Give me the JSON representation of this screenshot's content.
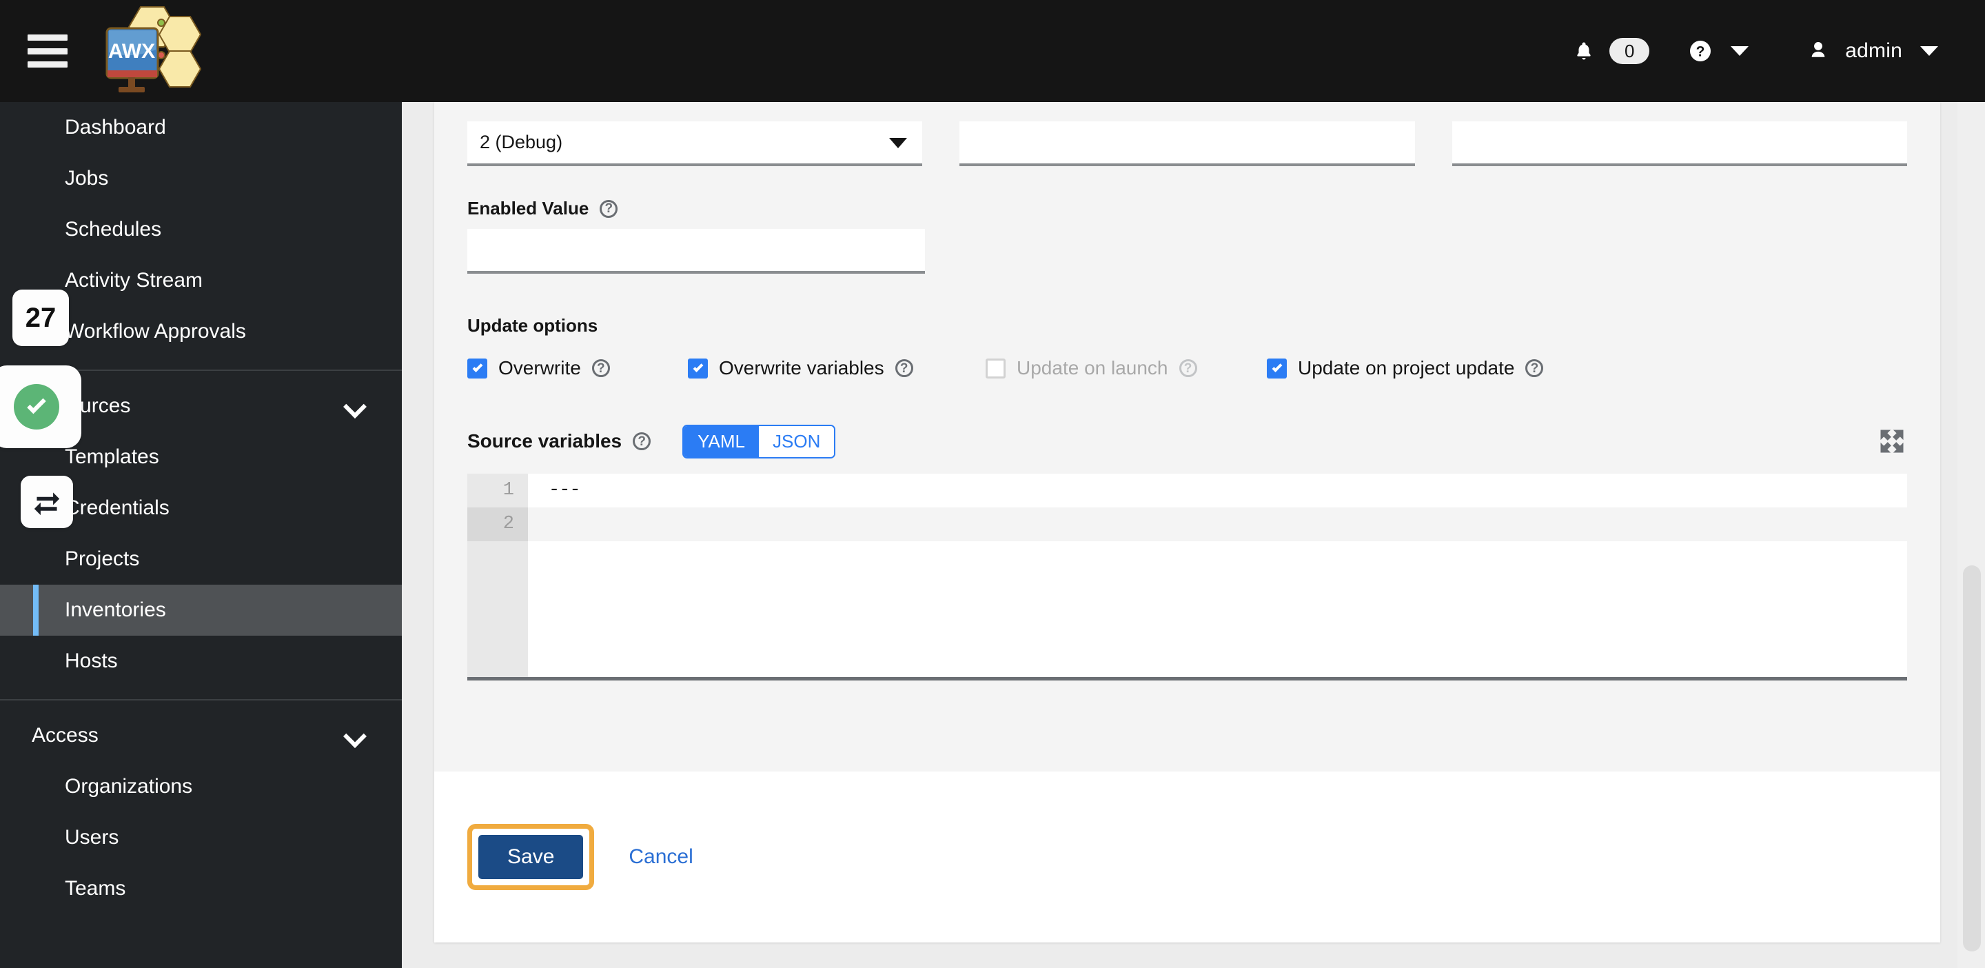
{
  "masthead": {
    "hamburger_icon": "hamburger-menu-icon",
    "brand_logo_text": "AWX",
    "bell_icon": "bell-icon",
    "notification_count": "0",
    "help_icon": "question-circle-icon",
    "help_caret_icon": "caret-down-icon",
    "user_icon": "user-avatar-icon",
    "user_name": "admin",
    "user_caret_icon": "caret-down-icon"
  },
  "sidebar": {
    "top_items": [
      {
        "label": "Dashboard"
      },
      {
        "label": "Jobs"
      },
      {
        "label": "Schedules"
      },
      {
        "label": "Activity Stream"
      },
      {
        "label": "Workflow Approvals"
      }
    ],
    "resources_section": {
      "label": "Resources",
      "chevron_icon": "chevron-down-icon"
    },
    "resources_items": [
      {
        "label": "Templates"
      },
      {
        "label": "Credentials"
      },
      {
        "label": "Projects"
      },
      {
        "label": "Inventories"
      },
      {
        "label": "Hosts"
      }
    ],
    "active_item": "Inventories",
    "access_section": {
      "label": "Access",
      "chevron_icon": "chevron-down-icon"
    },
    "access_items": [
      {
        "label": "Organizations"
      },
      {
        "label": "Users"
      },
      {
        "label": "Teams"
      }
    ]
  },
  "overlays": {
    "step_badge": "27",
    "check_icon": "green-check-circle-icon",
    "swap_icon": "swap-arrows-icon"
  },
  "form": {
    "verbosity": {
      "value": "2 (Debug)",
      "caret_icon": "caret-down-icon"
    },
    "field_b_value": "",
    "field_c_value": "",
    "enabled_value": {
      "label": "Enabled Value",
      "help_icon": "help-icon",
      "value": ""
    },
    "update_options": {
      "heading": "Update options",
      "checkboxes": [
        {
          "label": "Overwrite",
          "checked": true,
          "disabled": false,
          "help_icon": "help-icon"
        },
        {
          "label": "Overwrite variables",
          "checked": true,
          "disabled": false,
          "help_icon": "help-icon"
        },
        {
          "label": "Update on launch",
          "checked": false,
          "disabled": true,
          "help_icon": "help-icon"
        },
        {
          "label": "Update on project update",
          "checked": true,
          "disabled": false,
          "help_icon": "help-icon"
        }
      ]
    },
    "source_variables": {
      "label": "Source variables",
      "help_icon": "help-icon",
      "format_yaml": "YAML",
      "format_json": "JSON",
      "selected_format": "YAML",
      "expand_icon": "expand-arrows-icon",
      "lines": [
        {
          "number": "1",
          "text": "---"
        },
        {
          "number": "2",
          "text": ""
        }
      ]
    }
  },
  "footer": {
    "save_label": "Save",
    "cancel_label": "Cancel"
  },
  "colors": {
    "masthead_bg": "#151515",
    "sidebar_bg": "#212427",
    "active_nav_bg": "#4f5255",
    "active_nav_bar": "#73bcf7",
    "accent_blue": "#2b7cf4",
    "save_blue": "#1b4b86",
    "link_blue": "#2b6fd4",
    "highlight_orange": "#f0ab3f",
    "check_green": "#5cb576",
    "form_bg": "#f4f4f4"
  }
}
